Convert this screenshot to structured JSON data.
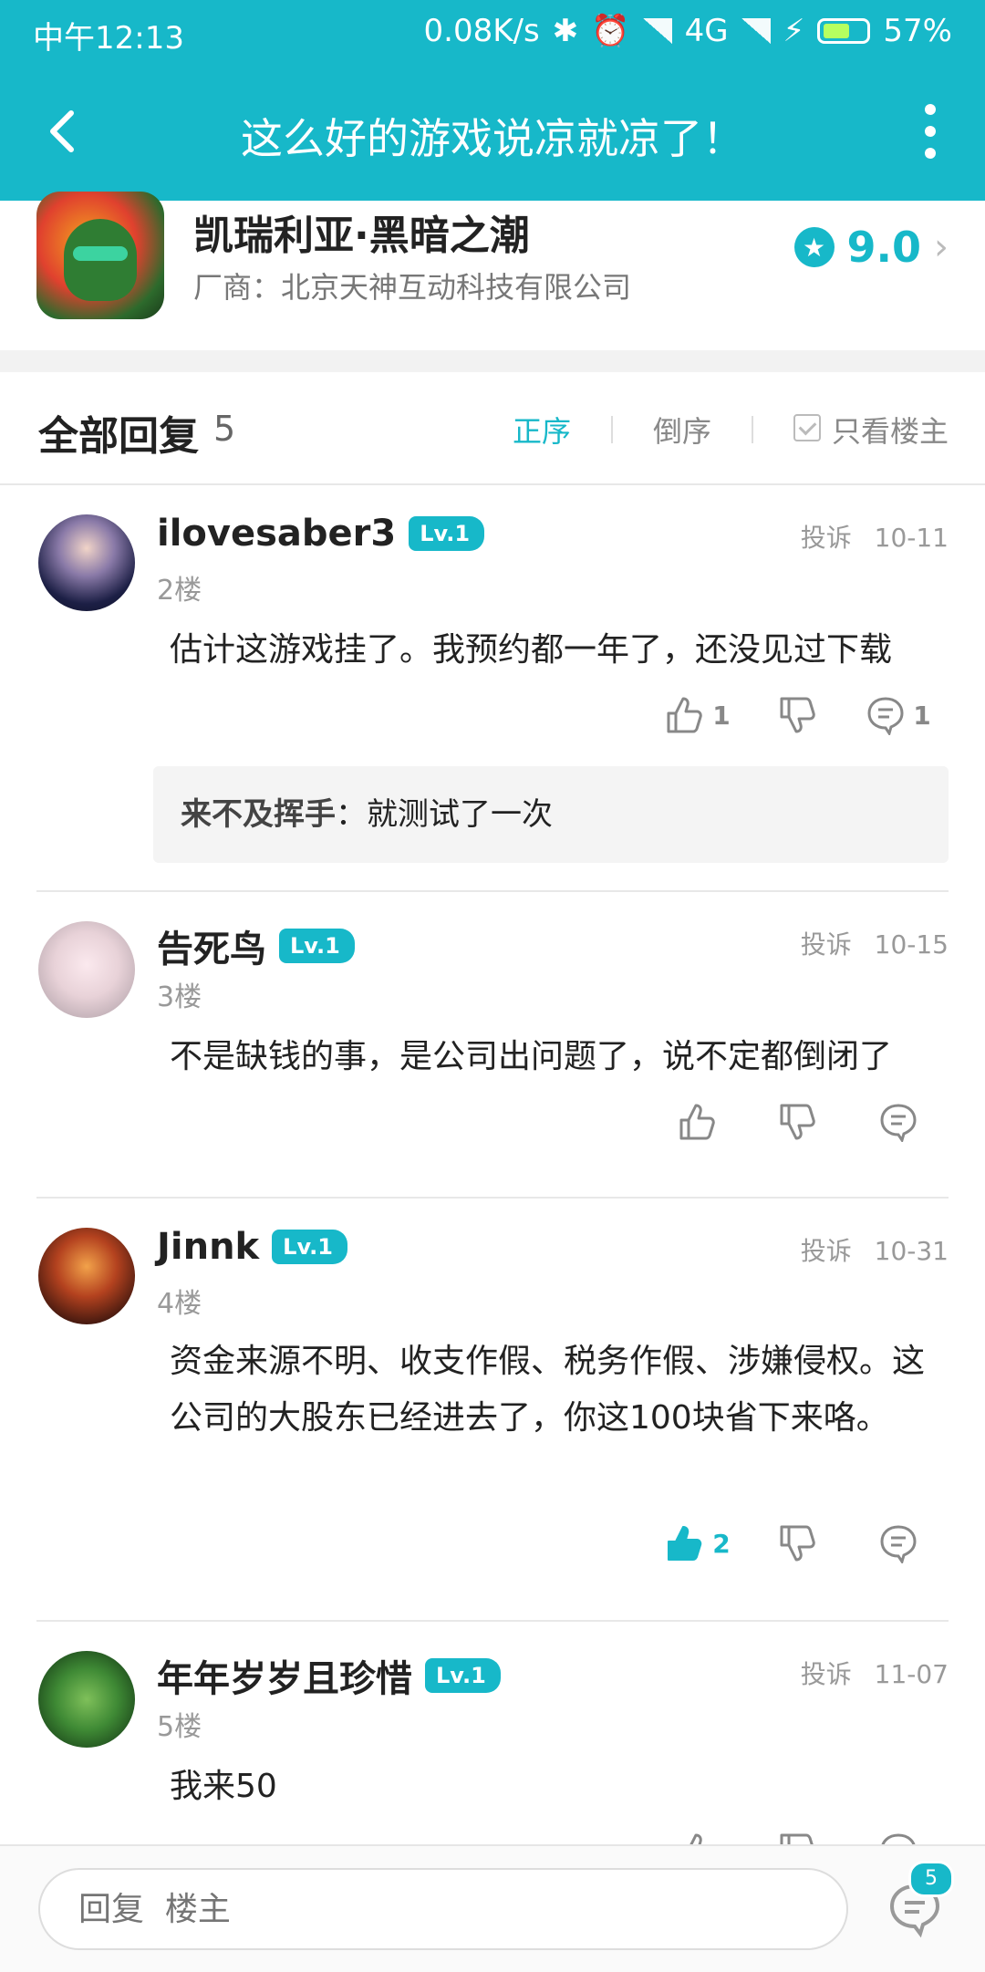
{
  "status_bar": {
    "time": "中午12:13",
    "speed": "0.08K/s",
    "network": "4G",
    "battery": "57%"
  },
  "nav": {
    "title": "这么好的游戏说凉就凉了！"
  },
  "game": {
    "name": "凯瑞利亚·黑暗之潮",
    "maker": "厂商：北京天神互动科技有限公司",
    "rating": "9.0",
    "accent_color": "#17b8c9"
  },
  "replies_header": {
    "label": "全部回复",
    "count": "5",
    "sort_asc": "正序",
    "sort_desc": "倒序",
    "only_op": "只看楼主"
  },
  "posts": [
    {
      "user": "ilovesaber3",
      "level": "Lv.1",
      "floor": "2楼",
      "report": "投诉",
      "date": "10-11",
      "content": "估计这游戏挂了。我预约都一年了，还没见过下载",
      "likes": "1",
      "comments": "1",
      "subreply_user": "来不及挥手",
      "subreply_text": "：就测试了一次"
    },
    {
      "user": "告死鸟",
      "level": "Lv.1",
      "floor": "3楼",
      "report": "投诉",
      "date": "10-15",
      "content": "不是缺钱的事，是公司出问题了，说不定都倒闭了",
      "likes": "",
      "comments": ""
    },
    {
      "user": "Jinnk",
      "level": "Lv.1",
      "floor": "4楼",
      "report": "投诉",
      "date": "10-31",
      "content": "资金来源不明、收支作假、税务作假、涉嫌侵权。这公司的大股东已经进去了，你这100块省下来咯。",
      "likes": "2",
      "comments": ""
    },
    {
      "user": "年年岁岁且珍惜",
      "level": "Lv.1",
      "floor": "5楼",
      "report": "投诉",
      "date": "11-07",
      "content": "我来50"
    }
  ],
  "bottom": {
    "reply_placeholder": "回复  楼主",
    "comment_badge": "5"
  }
}
